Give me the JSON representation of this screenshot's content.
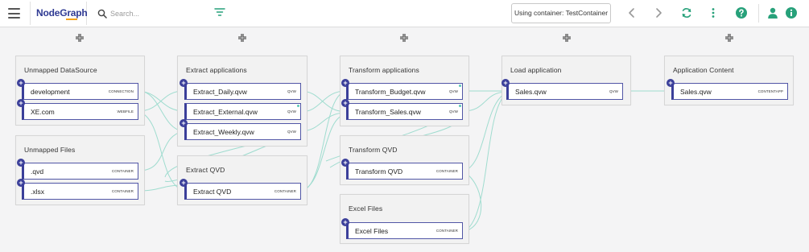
{
  "app": {
    "logo": "NodeGraph",
    "search_placeholder": "Search...",
    "container_button": "Using container: TestContainer"
  },
  "toolbar_icons": [
    "back-icon",
    "forward-icon",
    "refresh-icon",
    "more-icon",
    "help-icon",
    "user-icon",
    "info-icon"
  ],
  "colors": {
    "accent": "#3b3f9a",
    "edge": "#9fdccf",
    "toolbar_green": "#27a17a",
    "toolbar_gray": "#888888",
    "logo_underline": "#f2a11c"
  },
  "groups": [
    {
      "title": "Unmapped DataSource",
      "nodes": [
        {
          "label": "development",
          "type": "CONNECTION"
        },
        {
          "label": "XE.com",
          "type": "WEBFILE"
        }
      ]
    },
    {
      "title": "Unmapped Files",
      "nodes": [
        {
          "label": ".qvd",
          "type": "CONTAINER"
        },
        {
          "label": ".xlsx",
          "type": "CONTAINER"
        }
      ]
    },
    {
      "title": "Extract applications",
      "nodes": [
        {
          "label": "Extract_Daily.qvw",
          "type": "QVW"
        },
        {
          "label": "Extract_External.qvw",
          "type": "QVW"
        },
        {
          "label": "Extract_Weekly.qvw",
          "type": "QVW"
        }
      ]
    },
    {
      "title": "Extract QVD",
      "nodes": [
        {
          "label": "Extract QVD",
          "type": "CONTAINER"
        }
      ]
    },
    {
      "title": "Transform applications",
      "nodes": [
        {
          "label": "Transform_Budget.qvw",
          "type": "QVW"
        },
        {
          "label": "Transform_Sales.qvw",
          "type": "QVW"
        }
      ]
    },
    {
      "title": "Transform QVD",
      "nodes": [
        {
          "label": "Transform QVD",
          "type": "CONTAINER"
        }
      ]
    },
    {
      "title": "Excel Files",
      "nodes": [
        {
          "label": "Excel Files",
          "type": "CONTAINER"
        }
      ]
    },
    {
      "title": "Load application",
      "nodes": [
        {
          "label": "Sales.qvw",
          "type": "QVW"
        }
      ]
    },
    {
      "title": "Application Content",
      "nodes": [
        {
          "label": "Sales.qvw",
          "type": "CONTENTAPP"
        }
      ]
    }
  ]
}
